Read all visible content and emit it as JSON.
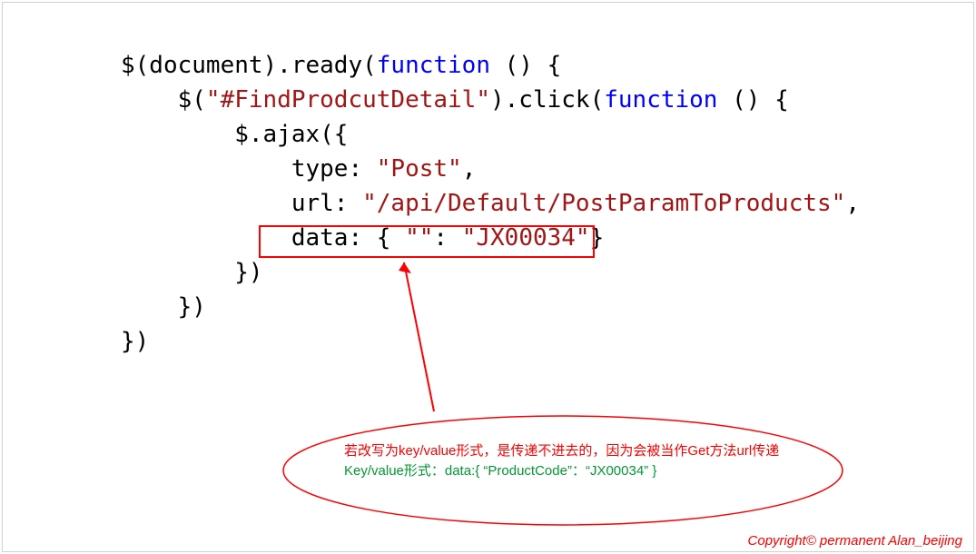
{
  "code": {
    "l1a": "$(document).ready(",
    "l1b": "function",
    "l1c": " () {",
    "l2a": "    $(",
    "l2b": "\"#FindProdcutDetail\"",
    "l2c": ").click(",
    "l2d": "function",
    "l2e": " () {",
    "l3": "        $.ajax({",
    "l4a": "            type: ",
    "l4b": "\"Post\"",
    "l4c": ",",
    "l5a": "            url: ",
    "l5b": "\"/api/Default/PostParamToProducts\"",
    "l5c": ",",
    "l6a": "            data: { ",
    "l6b": "\"\"",
    "l6c": ": ",
    "l6d": "\"JX00034\"",
    "l6e": "}",
    "l7": "        })",
    "l8": "    })",
    "l9": "})"
  },
  "note": {
    "red_line": "若改写为key/value形式，是传递不进去的，因为会被当作Get方法url传递",
    "green_line": "Key/value形式：data:{ “ProductCode”：“JX00034” }"
  },
  "copyright": "Copyright© permanent  Alan_beijing"
}
